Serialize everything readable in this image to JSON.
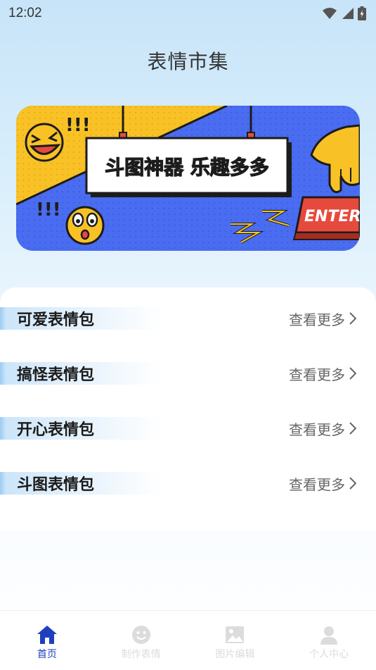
{
  "status_bar": {
    "time": "12:02"
  },
  "header": {
    "title": "表情市集"
  },
  "banner": {
    "headline": "斗图神器 乐趣多多",
    "exclaim_1": "!!!",
    "exclaim_2": "!!!",
    "key_text": "ENTER"
  },
  "sections": [
    {
      "title": "可爱表情包",
      "more": "查看更多"
    },
    {
      "title": "搞怪表情包",
      "more": "查看更多"
    },
    {
      "title": "开心表情包",
      "more": "查看更多"
    },
    {
      "title": "斗图表情包",
      "more": "查看更多"
    }
  ],
  "nav": {
    "items": [
      {
        "label": "首页",
        "icon": "home-icon",
        "active": true
      },
      {
        "label": "制作表情",
        "icon": "smiley-icon",
        "active": false
      },
      {
        "label": "图片编辑",
        "icon": "image-icon",
        "active": false
      },
      {
        "label": "个人中心",
        "icon": "user-icon",
        "active": false
      }
    ]
  },
  "colors": {
    "accent": "#1f3fbf",
    "banner_yellow": "#f8c226",
    "banner_blue": "#4a6cf0"
  }
}
